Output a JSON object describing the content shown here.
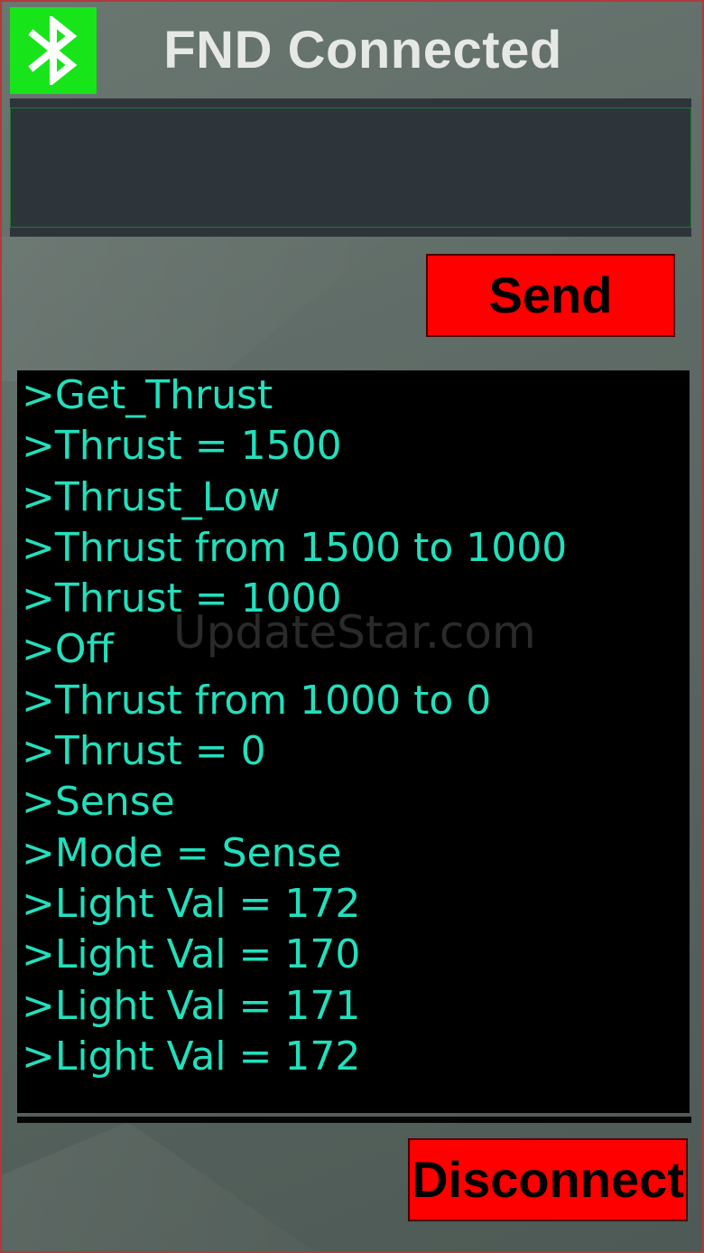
{
  "header": {
    "title": "FND Connected",
    "bluetooth_icon": "bluetooth-icon",
    "bluetooth_status_color": "#17e51a"
  },
  "input": {
    "value": "",
    "placeholder": ""
  },
  "send": {
    "label": "Send",
    "color": "#ff0000"
  },
  "console": {
    "text_color": "#22e0bd",
    "lines": [
      ">Get_Thrust",
      ">Thrust = 1500",
      ">Thrust_Low",
      ">Thrust from 1500 to 1000",
      ">Thrust = 1000",
      ">Off",
      ">Thrust from 1000 to 0",
      ">Thrust = 0",
      ">Sense",
      ">Mode = Sense",
      ">Light Val = 172",
      ">Light Val = 170",
      ">Light Val = 171",
      ">Light Val = 172"
    ]
  },
  "watermark": "UpdateStar.com",
  "disconnect": {
    "label": "Disconnect",
    "color": "#ff0000"
  }
}
